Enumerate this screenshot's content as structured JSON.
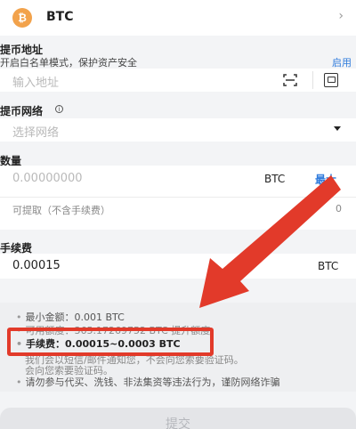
{
  "coin": {
    "symbol_glyph": "₿",
    "name": "BTC"
  },
  "address": {
    "label": "提币地址",
    "whitelist_hint": "开启白名单模式，保护资产安全",
    "whitelist_link": "启用",
    "placeholder": "输入地址"
  },
  "network": {
    "label": "提币网络",
    "placeholder": "选择网络"
  },
  "amount": {
    "label": "数量",
    "placeholder": "0.00000000",
    "unit": "BTC",
    "max_label": "最大",
    "receivable_label": "可提取（不含手续费）",
    "receivable_value": "0"
  },
  "fee": {
    "label": "手续费",
    "value": "0.00015",
    "unit": "BTC"
  },
  "notes": [
    "最小金额：0.001 BTC",
    "可用额度：365.17269752 BTC 提升额度",
    "手续费：0.00015~0.0003 BTC",
    "我们会以短信/邮件通知您，不会向您索要验证码。",
    "会向您索要验证码。",
    "请勿参与代买、洗钱、非法集资等违法行为，谨防网络诈骗"
  ],
  "submit_label": "提交",
  "colors": {
    "accent": "#2f7bdc",
    "annotation_red": "#e23a2a",
    "bitcoin_orange": "#f2a24b"
  }
}
